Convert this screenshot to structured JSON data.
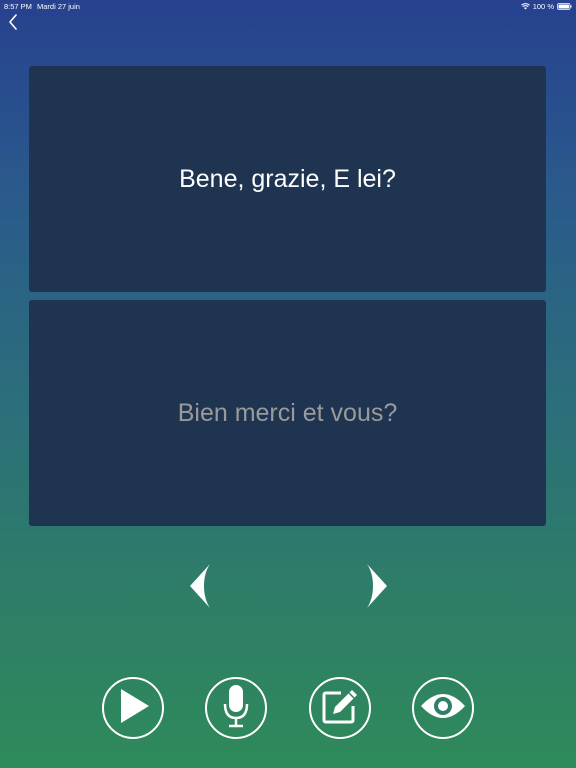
{
  "status_bar": {
    "time": "8:57 PM",
    "date": "Mardi 27 juin",
    "battery": "100 %"
  },
  "cards": {
    "question": "Bene, grazie, E lei?",
    "answer": "Bien merci et vous?"
  },
  "icons": {
    "back": "chevron-left-icon",
    "prev": "triangle-left-icon",
    "next": "triangle-right-icon",
    "play": "play-icon",
    "mic": "microphone-icon",
    "edit": "edit-icon",
    "eye": "eye-icon"
  },
  "colors": {
    "gradient_top": "#27418f",
    "gradient_bottom": "#2e8a5a",
    "card_bg": "#1f3450",
    "answer_text": "#9a9a9a"
  }
}
